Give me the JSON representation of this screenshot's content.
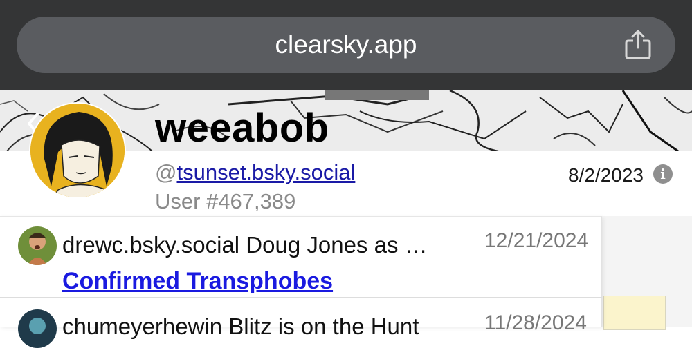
{
  "browser": {
    "url": "clearsky.app",
    "share_icon": "share-icon"
  },
  "profile": {
    "display_name": "weeabob",
    "handle_prefix": "@",
    "handle": "tsunset.bsky.social",
    "user_number": "User #467,389",
    "joined": "8/2/2023",
    "info_icon": "info-icon",
    "info_glyph": "i",
    "back_icon": "chevron-left-icon",
    "back_glyph": "‹"
  },
  "lists": [
    {
      "title": "drewc.bsky.social Doug Jones as …",
      "date": "12/21/2024",
      "link_label": "Confirmed Transphobes"
    },
    {
      "title": "chumeyerhewin Blitz is on the Hunt",
      "date": "11/28/2024"
    }
  ],
  "colors": {
    "topbar": "#343536",
    "urlbar": "#5a5c60",
    "link": "#1a1aa6",
    "list_link": "#1a1ae0",
    "avatar_bg": "#e8b21f"
  }
}
